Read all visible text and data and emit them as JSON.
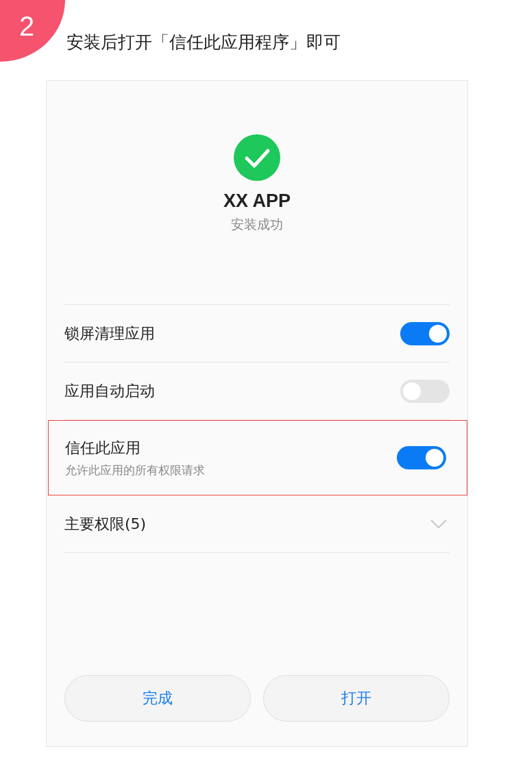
{
  "step": {
    "number": "2"
  },
  "instruction": "安装后打开「信任此应用程序」即可",
  "app": {
    "name": "XX APP",
    "status": "安装成功"
  },
  "settings": [
    {
      "kind": "toggle",
      "label": "锁屏清理应用",
      "on": true,
      "highlighted": false
    },
    {
      "kind": "toggle",
      "label": "应用自动启动",
      "on": false,
      "highlighted": false
    },
    {
      "kind": "toggle",
      "label": "信任此应用",
      "description": "允许此应用的所有权限请求",
      "on": true,
      "highlighted": true
    },
    {
      "kind": "expander",
      "label": "主要权限(5)",
      "expanded": false,
      "highlighted": false
    }
  ],
  "buttons": [
    {
      "label": "完成"
    },
    {
      "label": "打开"
    }
  ]
}
